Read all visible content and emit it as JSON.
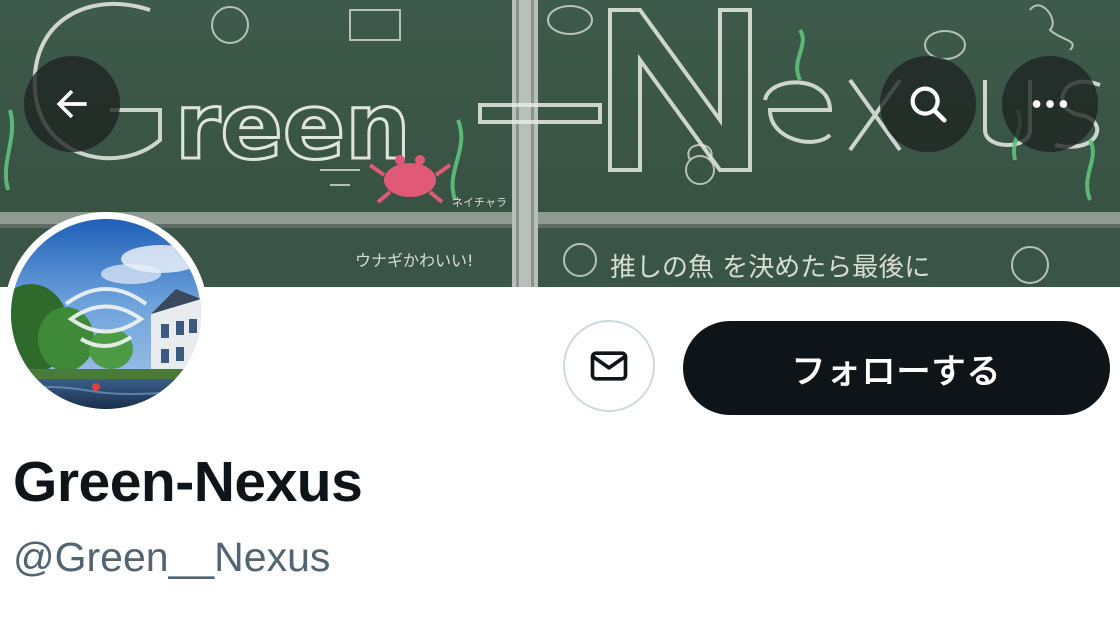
{
  "banner": {
    "chalk_title": "Green-Nexus",
    "chalk_notes": [
      "推しの魚 を決めたら最後に",
      "ウナギかわいい!",
      "ネイチャラ"
    ]
  },
  "header": {
    "back_icon": "arrow-left-icon",
    "search_icon": "search-icon",
    "more_icon": "more-horizontal-icon"
  },
  "actions": {
    "message_icon": "envelope-icon",
    "follow_label": "フォローする"
  },
  "profile": {
    "display_name": "Green-Nexus",
    "handle": "@Green__Nexus"
  },
  "colors": {
    "follow_bg": "#0f1419",
    "handle_text": "#536471",
    "chalkboard": "#3d5a4b"
  }
}
